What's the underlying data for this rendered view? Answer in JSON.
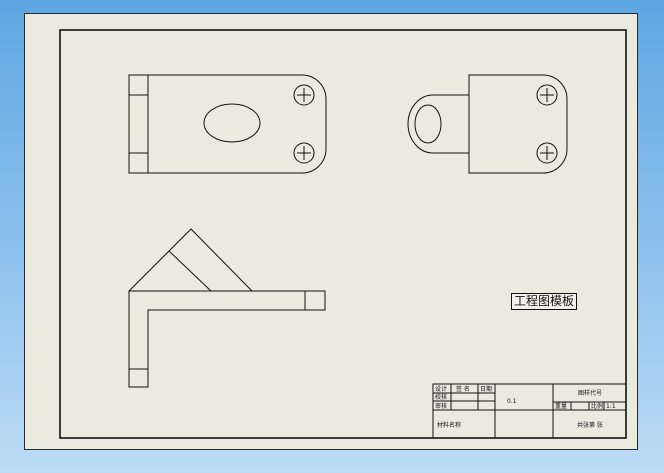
{
  "template_label": "工程图模板",
  "title_block": {
    "row1": [
      "设计",
      "签 名",
      "日期"
    ],
    "row2": "校核",
    "row3": "审核",
    "scale_value": "0.1",
    "drawing_number": "图样代号",
    "weight_label": "重量",
    "ratio_label": "比例",
    "ratio_value": "1:1",
    "material": "材料名称",
    "sheet_info": "共张第 张"
  },
  "colors": {
    "sheet": "#eaeade",
    "line": "#111111",
    "background_top": "#5ea7e3",
    "background_bottom": "#bcdcf6"
  }
}
